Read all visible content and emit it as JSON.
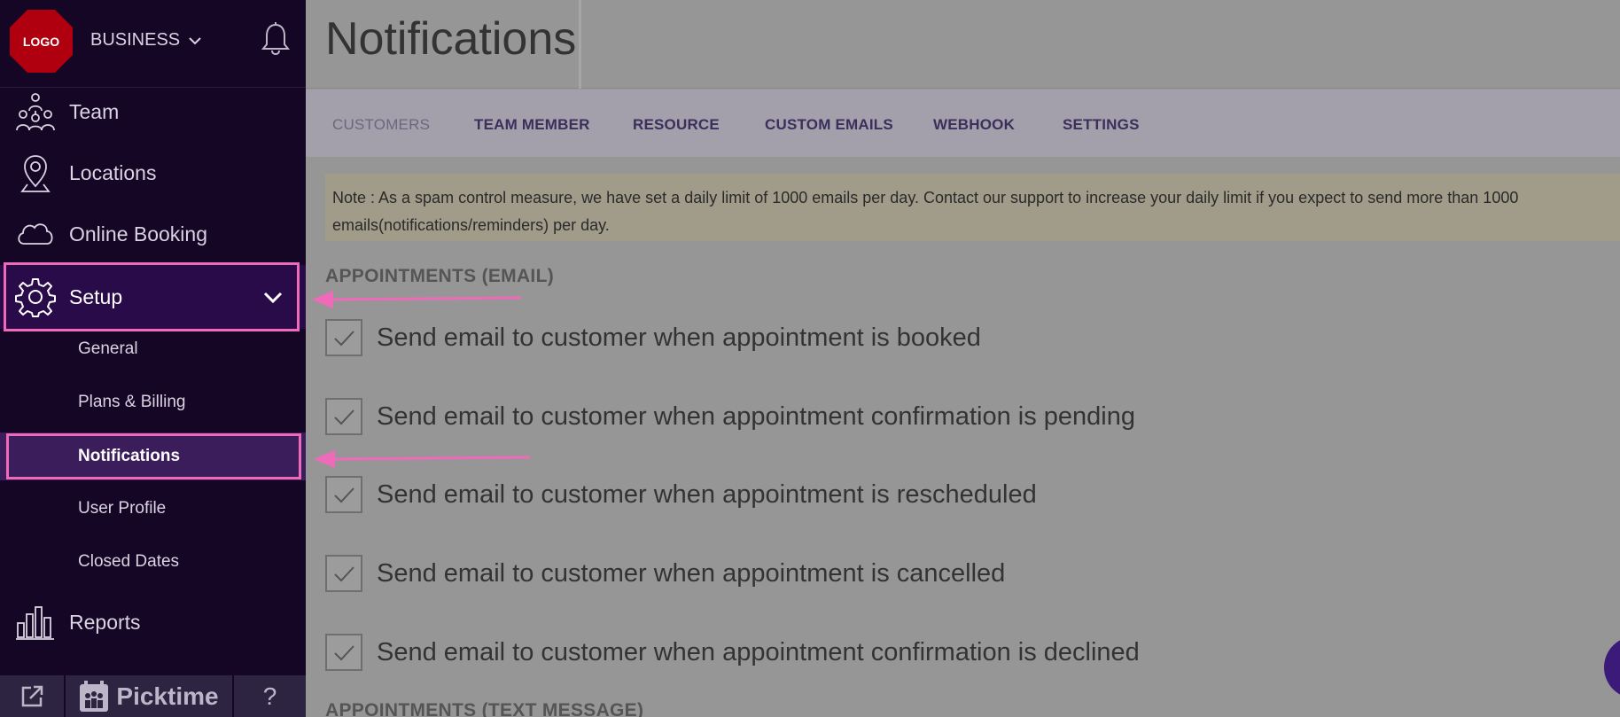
{
  "sidebar": {
    "logo_text": "LOGO",
    "business_label": "BUSINESS",
    "nav": [
      {
        "label": "Team",
        "icon": "team-icon"
      },
      {
        "label": "Locations",
        "icon": "location-pin-icon"
      },
      {
        "label": "Online Booking",
        "icon": "cloud-icon"
      },
      {
        "label": "Setup",
        "icon": "gear-icon"
      },
      {
        "label": "Reports",
        "icon": "bar-chart-icon"
      }
    ],
    "setup_items": [
      {
        "label": "General"
      },
      {
        "label": "Plans & Billing"
      },
      {
        "label": "Notifications"
      },
      {
        "label": "User Profile"
      },
      {
        "label": "Closed Dates"
      }
    ],
    "footer": {
      "brand": "Picktime",
      "help": "?"
    }
  },
  "main": {
    "title": "Notifications",
    "tabs": [
      {
        "label": "CUSTOMERS"
      },
      {
        "label": "TEAM MEMBER"
      },
      {
        "label": "RESOURCE"
      },
      {
        "label": "CUSTOM EMAILS"
      },
      {
        "label": "WEBHOOK"
      },
      {
        "label": "SETTINGS"
      }
    ],
    "note": "Note : As a spam control measure, we have set a daily limit of 1000 emails per day. Contact our support to increase your daily limit if you expect to send more than 1000 emails(notifications/reminders) per day.",
    "sections": [
      {
        "title": "APPOINTMENTS (EMAIL)",
        "options": [
          {
            "label": "Send email to customer when appointment is booked",
            "checked": true
          },
          {
            "label": "Send email to customer when appointment confirmation is pending",
            "checked": true
          },
          {
            "label": "Send email to customer when appointment is rescheduled",
            "checked": true
          },
          {
            "label": "Send email to customer when appointment is cancelled",
            "checked": true
          },
          {
            "label": "Send email to customer when appointment confirmation is declined",
            "checked": true
          }
        ]
      },
      {
        "title": "APPOINTMENTS (TEXT MESSAGE)"
      }
    ]
  },
  "colors": {
    "sidebar_bg": "#150626",
    "highlight": "#f06aba",
    "active_sub_bg": "#3b1d5c",
    "overlay_bg": "#969696"
  }
}
